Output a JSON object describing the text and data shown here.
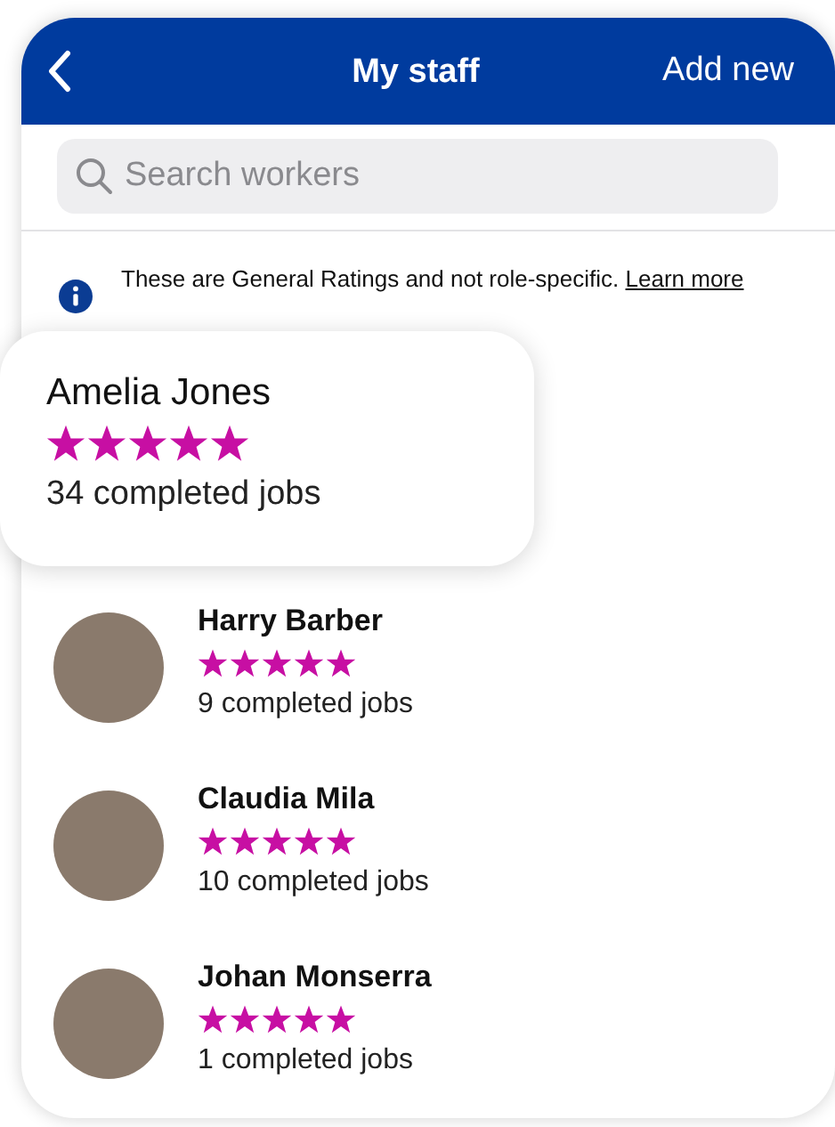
{
  "header": {
    "title": "My staff",
    "action": "Add new"
  },
  "search": {
    "placeholder": "Search workers"
  },
  "notice": {
    "text": "These are General Ratings and not role-specific.",
    "link": "Learn more"
  },
  "highlighted_worker": {
    "name": "Amelia Jones",
    "stars": 5,
    "jobs": "34 completed jobs"
  },
  "workers": [
    {
      "name": "Harry Barber",
      "stars": 5,
      "jobs": "9 completed jobs"
    },
    {
      "name": "Claudia Mila",
      "stars": 5,
      "jobs": "10 completed jobs"
    },
    {
      "name": "Johan Monserra",
      "stars": 5,
      "jobs": "1 completed jobs"
    }
  ]
}
